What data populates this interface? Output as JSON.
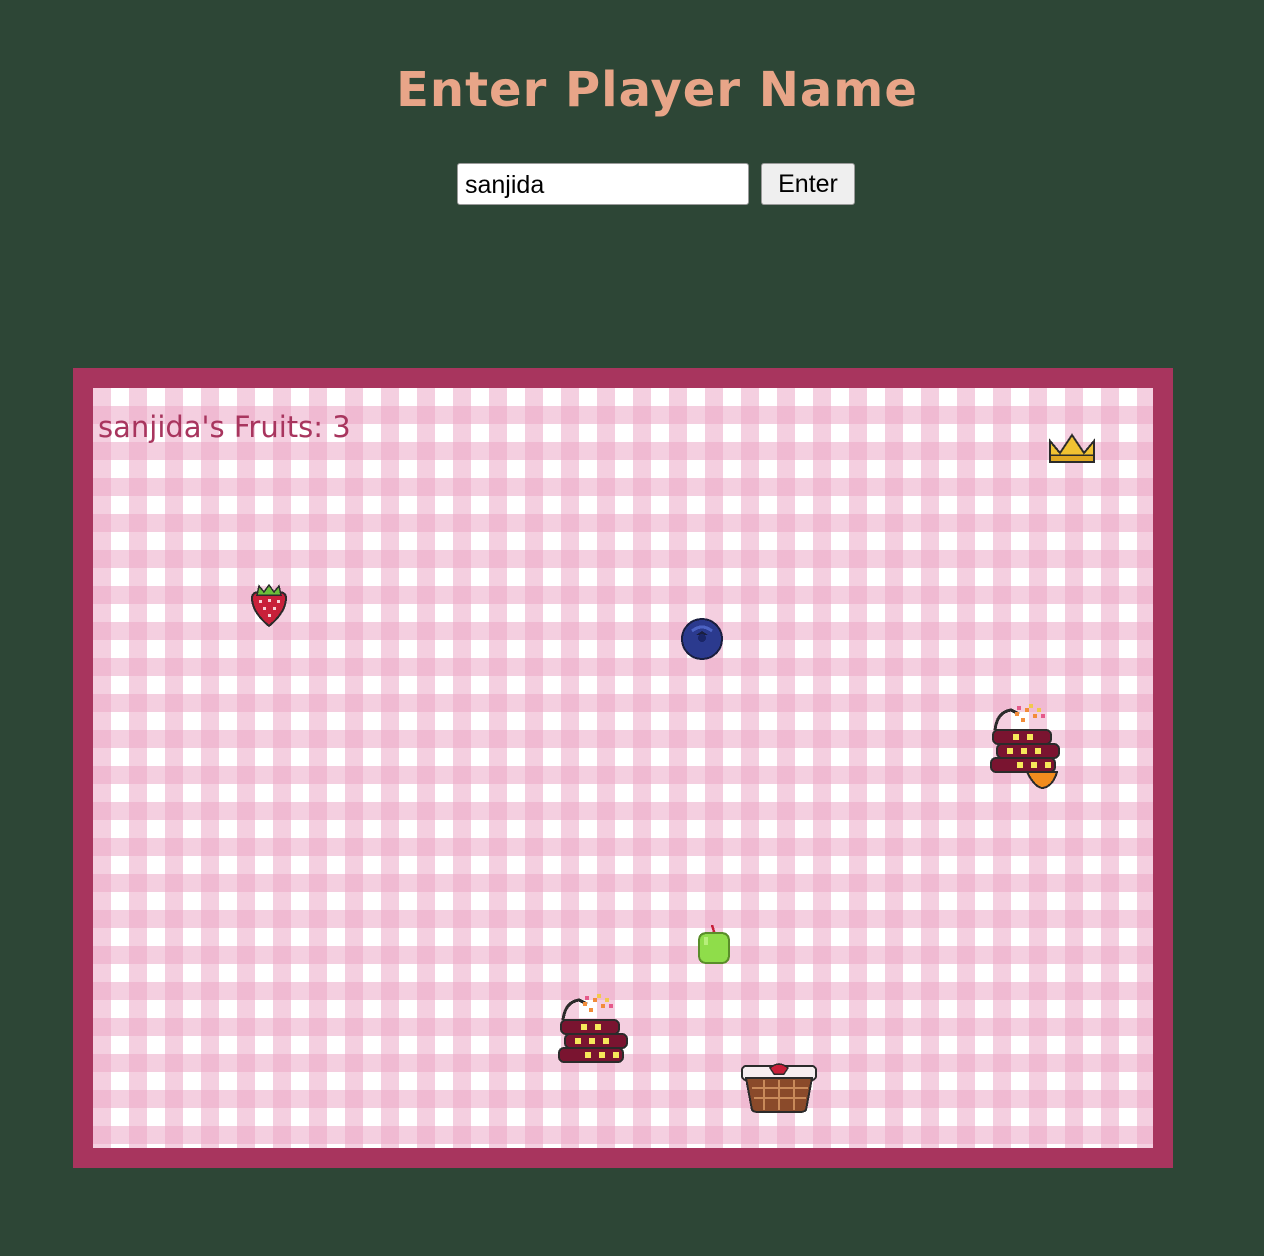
{
  "header": {
    "title": "Enter Player Name"
  },
  "form": {
    "name_value": "sanjida",
    "enter_label": "Enter"
  },
  "game": {
    "player_name": "sanjida",
    "score_label": "sanjida's Fruits: 3",
    "fruits_collected": 3,
    "sprites": [
      "crown-icon",
      "strawberry-icon",
      "blueberry-icon",
      "green-apple-icon",
      "cake-stack-icon",
      "cake-stack-icon",
      "picnic-basket-icon"
    ]
  },
  "colors": {
    "background": "#2d4636",
    "title": "#e8a588",
    "frame": "#a8355e",
    "tablecloth": "#eca8c6",
    "score_text": "#a8355e"
  }
}
